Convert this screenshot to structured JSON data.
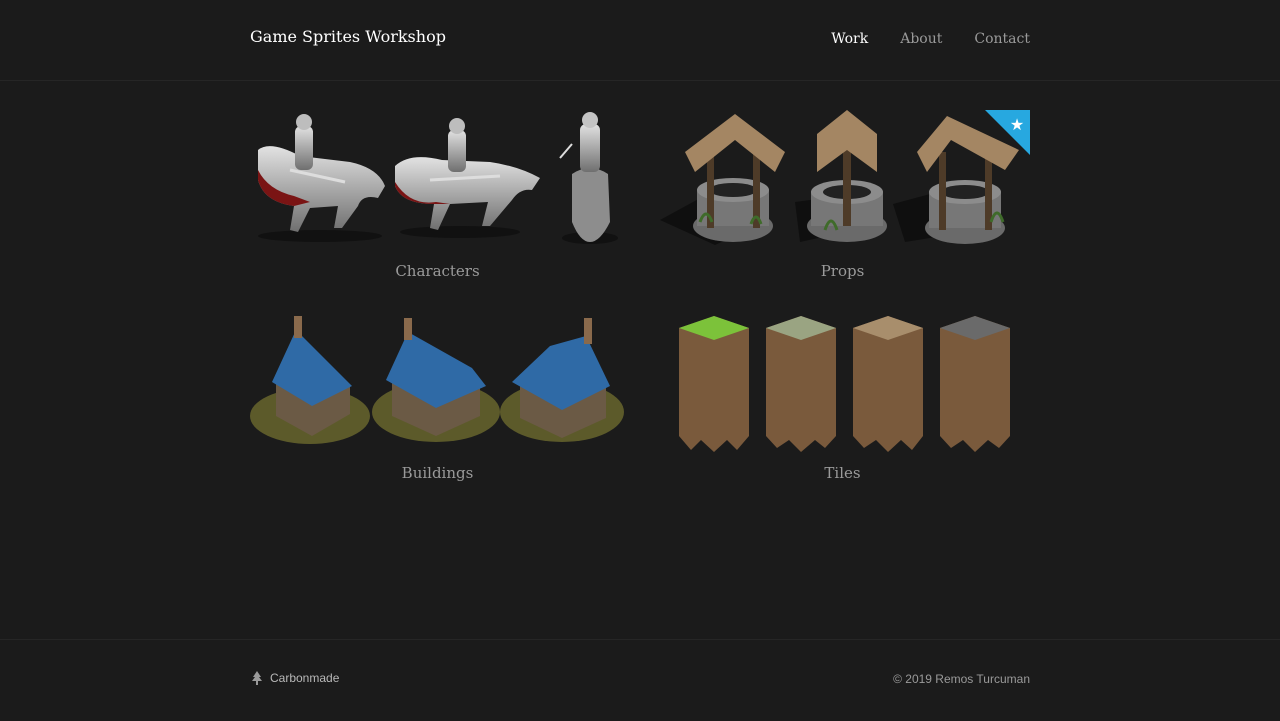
{
  "site": {
    "title": "Game Sprites Workshop"
  },
  "nav": [
    {
      "label": "Work",
      "active": true
    },
    {
      "label": "About",
      "active": false
    },
    {
      "label": "Contact",
      "active": false
    }
  ],
  "projects": [
    {
      "label": "Characters",
      "thumbnail": "armored-knights-on-horses"
    },
    {
      "label": "Props",
      "thumbnail": "stone-wells",
      "badge": "featured-star-icon"
    },
    {
      "label": "Buildings",
      "thumbnail": "blue-roof-houses"
    },
    {
      "label": "Tiles",
      "thumbnail": "terrain-columns"
    }
  ],
  "footer": {
    "brand": "Carbonmade",
    "copyright": "© 2019 Remos Turcuman"
  },
  "colors": {
    "background": "#1b1b1b",
    "badge": "#27a8e0",
    "text_muted": "#9a9a9a",
    "text_active": "#ffffff"
  }
}
